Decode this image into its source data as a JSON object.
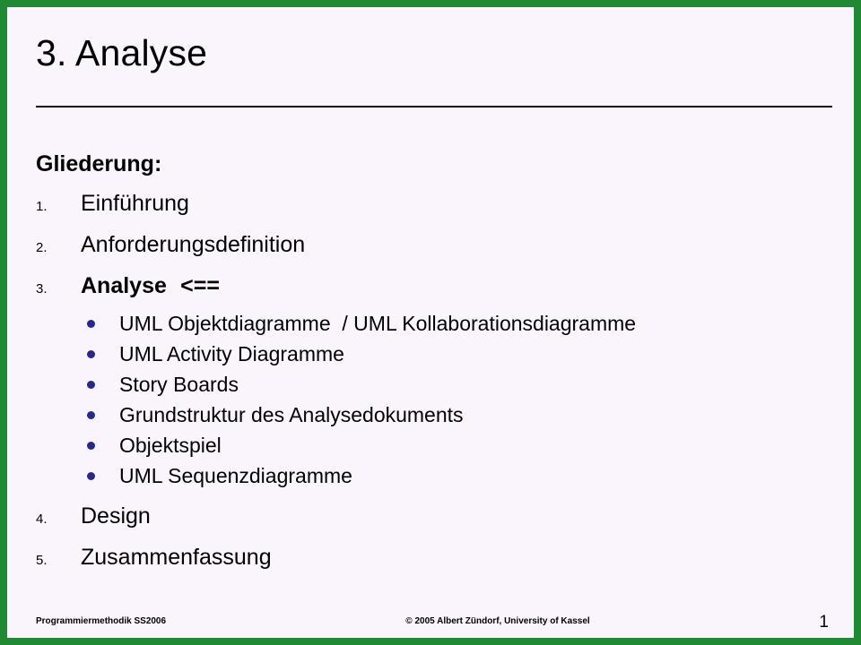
{
  "slide": {
    "title": "3. Analyse",
    "border_color": "#1f8a33",
    "background_color": "#faf5fc",
    "bullet_color": "#27288c",
    "outline_heading": "Gliederung:",
    "numbered_items": [
      {
        "marker": "1.",
        "text": "Einführung",
        "bold": false
      },
      {
        "marker": "2.",
        "text": "Anforderungsdefinition",
        "bold": false
      },
      {
        "marker": "3.",
        "text": "Analyse\t<==",
        "bold": true
      },
      {
        "marker": "4.",
        "text": "Design",
        "bold": false
      },
      {
        "marker": "5.",
        "text": "Zusammenfassung",
        "bold": false
      }
    ],
    "sub_items": [
      "UML Objektdiagramme  / UML Kollaborationsdiagramme",
      "UML Activity Diagramme",
      "Story Boards",
      "Grundstruktur des Analysedokuments",
      "Objektspiel",
      "UML Sequenzdiagramme"
    ]
  },
  "footer": {
    "left": "Programmiermethodik SS2006",
    "copyright": "© 2005 Albert Zündorf, University of Kassel",
    "page_number": "1"
  }
}
